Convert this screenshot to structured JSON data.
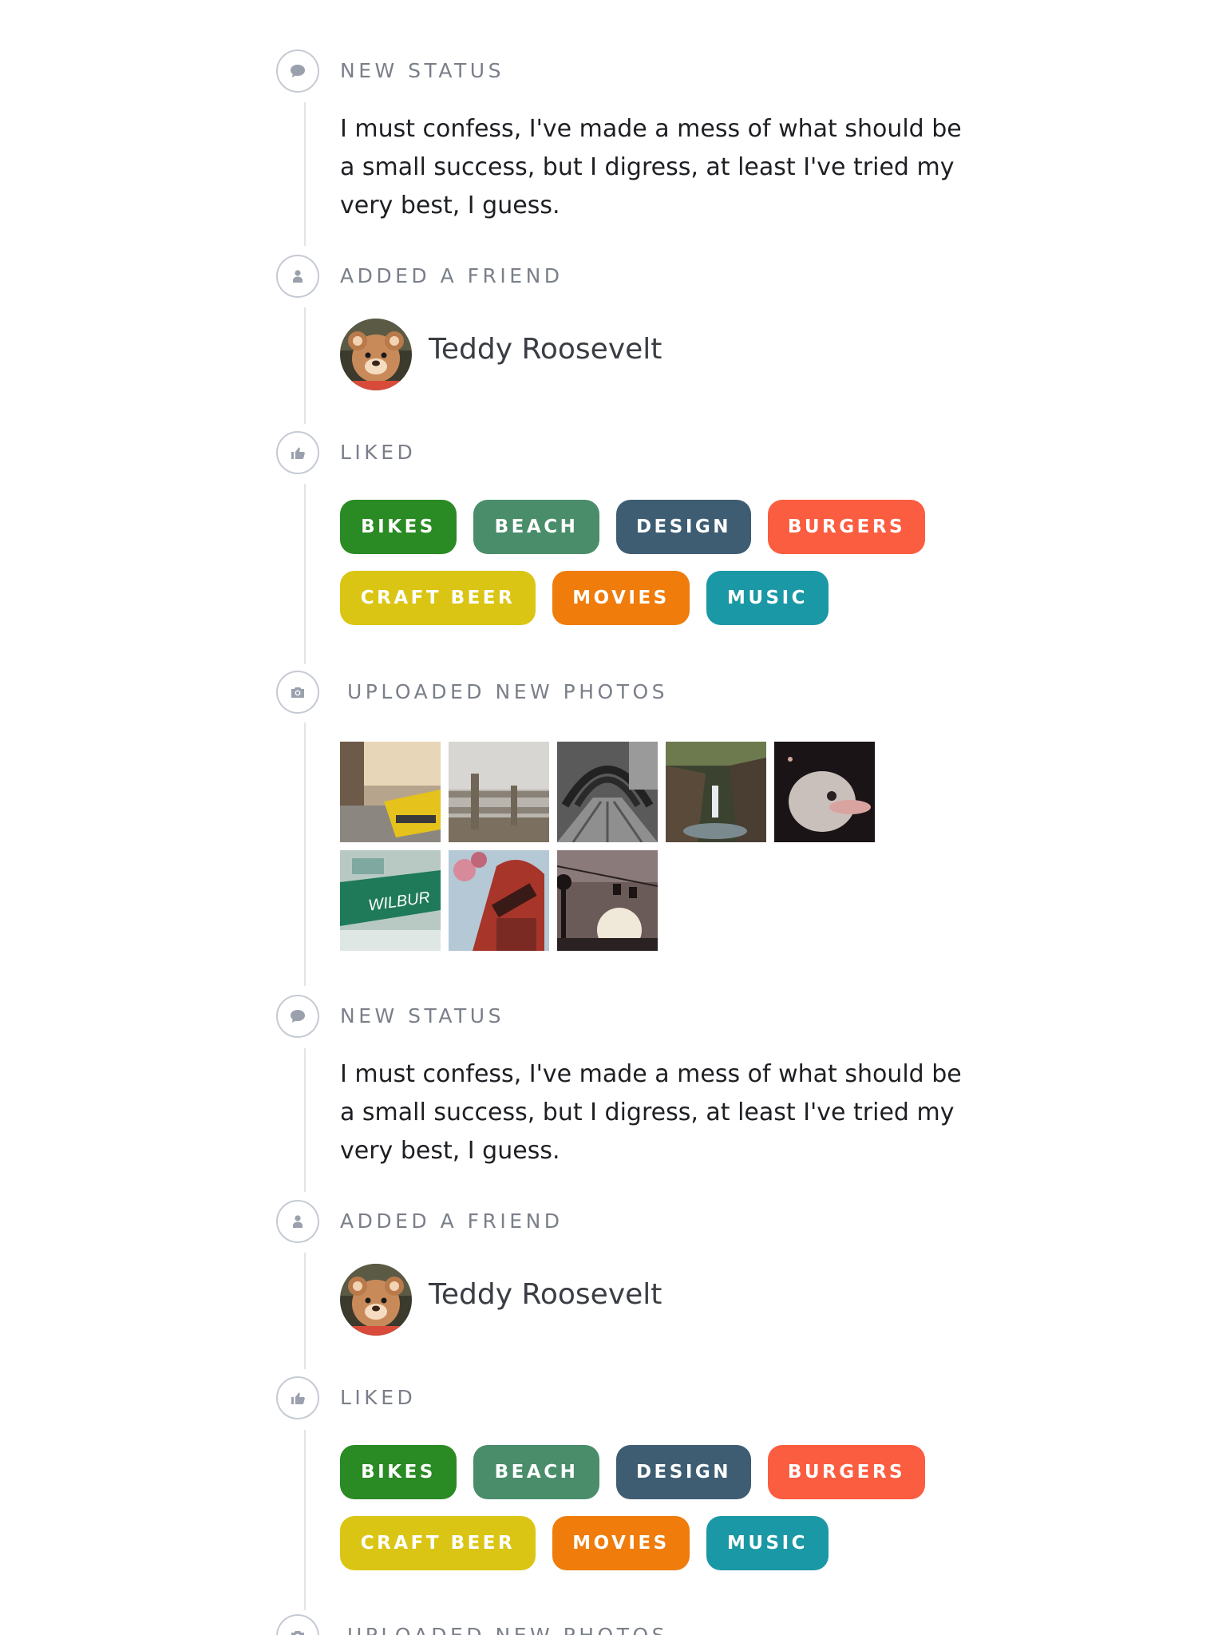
{
  "colors": {
    "bikes": "#2a8a23",
    "beach": "#4a8d6a",
    "design": "#3e5d72",
    "burgers": "#fb5d40",
    "craft_beer": "#dbc514",
    "movies": "#ef7c0b",
    "music": "#1b98a5",
    "rail": "#e1e4e9",
    "icon_stroke": "#c5cad3"
  },
  "entries": [
    {
      "type": "status",
      "label": "NEW STATUS",
      "icon": "speech-bubble-icon",
      "text": "I must confess, I've made a mess of what should be a small success, but I digress, at least I've tried my very best, I guess."
    },
    {
      "type": "friend",
      "label": "ADDED A FRIEND",
      "icon": "person-icon",
      "friend_name": "Teddy Roosevelt",
      "avatar": "teddy-bear-avatar"
    },
    {
      "type": "liked",
      "label": "LIKED",
      "icon": "thumbs-up-icon",
      "tags": [
        "BIKES",
        "BEACH",
        "DESIGN",
        "BURGERS",
        "CRAFT BEER",
        "MOVIES",
        "MUSIC"
      ]
    },
    {
      "type": "photos",
      "label": "UPLOADED NEW PHOTOS",
      "icon": "camera-icon",
      "photos": [
        "taxi-street-photo",
        "wooden-fence-photo",
        "tunnel-walkway-photo",
        "waterfall-canyon-photo",
        "ostrich-photo",
        "wilbur-sign-photo",
        "telephone-booth-photo",
        "cable-car-sunset-photo"
      ]
    },
    {
      "type": "status",
      "label": "NEW STATUS",
      "icon": "speech-bubble-icon",
      "text": "I must confess, I've made a mess of what should be a small success, but I digress, at least I've tried my very best, I guess."
    },
    {
      "type": "friend",
      "label": "ADDED A FRIEND",
      "icon": "person-icon",
      "friend_name": "Teddy Roosevelt",
      "avatar": "teddy-bear-avatar"
    },
    {
      "type": "liked",
      "label": "LIKED",
      "icon": "thumbs-up-icon",
      "tags": [
        "BIKES",
        "BEACH",
        "DESIGN",
        "BURGERS",
        "CRAFT BEER",
        "MOVIES",
        "MUSIC"
      ]
    },
    {
      "type": "photos",
      "label": "UPLOADED NEW PHOTOS",
      "icon": "camera-icon"
    }
  ],
  "photo_text": {
    "wilbur": "WILBUR"
  }
}
